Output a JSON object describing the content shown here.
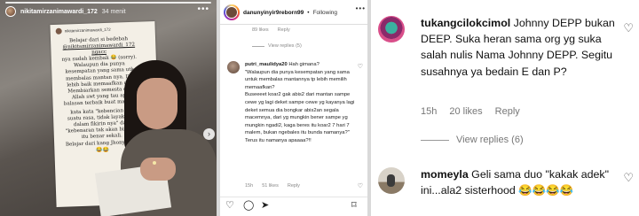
{
  "story": {
    "username": "nikitamirzanimawardi_172",
    "time": "34 menit",
    "more": "•••",
    "next": "›",
    "note_header": "nikitamirzanimawardi_172",
    "note_lines": [
      "Belajar dari si bedebah",
      "@nikitamirzanimawardi_172 ngacc",
      "nya sudah kembali 😂 (sorry).",
      "Walaupun dia punya",
      "kesempatan yang sama utk",
      "membalas mantan nya. Dia",
      "lebih baik memaafkan dan",
      "Membiarkan semesta dan",
      "Allah swt yang tau apa",
      "balasan terbaik buat mantan."
    ],
    "note_lines_2": [
      "kata kata \"kebencian itu",
      "suatu rasa, tidak layak ada",
      "dalam fikirin nya\" dan",
      "\"kebenaran tak akan binasa\"",
      "itu benar sekali.",
      "Belajar dari kang Jhony deep",
      "😂😂"
    ]
  },
  "post": {
    "username": "danunyinyir9reborn99",
    "dot": "•",
    "follow": "Following",
    "more": "•••",
    "top_likes": "89 likes",
    "top_reply": "Reply",
    "view_replies": "View replies (5)",
    "comment": {
      "user": "putri_maulidya20",
      "text": "Hah gimana?\n\"Walaupun dia punya kesempatan yang sama untuk membalas mantannya tp lebih memilih memaafkan?\nBuseeeet koar2 gak abis2 dari mantan sampe cewe yg lagi deket sampe cewe yg kayanya lagi deket semua dia bongkar abis2an segala macemnya, dari yg mungkin bener sampe yg mungkin ngadi2, kaga beres itu koar2 7 hari 7 malem, bukan ngebales itu bunda namanya?\" Terus itu namanya apaaaa?!!",
      "age": "15h",
      "likes": "51 likes",
      "reply": "Reply"
    },
    "actions": [
      "♡",
      "◯",
      "➤",
      "⌑"
    ]
  },
  "zoom": {
    "comment1": {
      "user": "tukangcilokcimol",
      "text": " Johnny DEPP bukan DEEP. Suka heran sama org yg suka salah nulis Nama Johnny DEPP. Segitu susahnya ya bedain E dan P?",
      "age": "15h",
      "likes": "20 likes",
      "reply": "Reply"
    },
    "view_replies": "View replies (6)",
    "comment2": {
      "user": "momeyla",
      "text": " Geli sama duo \"kakak adek\" ini...ala2 sisterhood 😂😂😂😂"
    },
    "heart": "♡"
  }
}
